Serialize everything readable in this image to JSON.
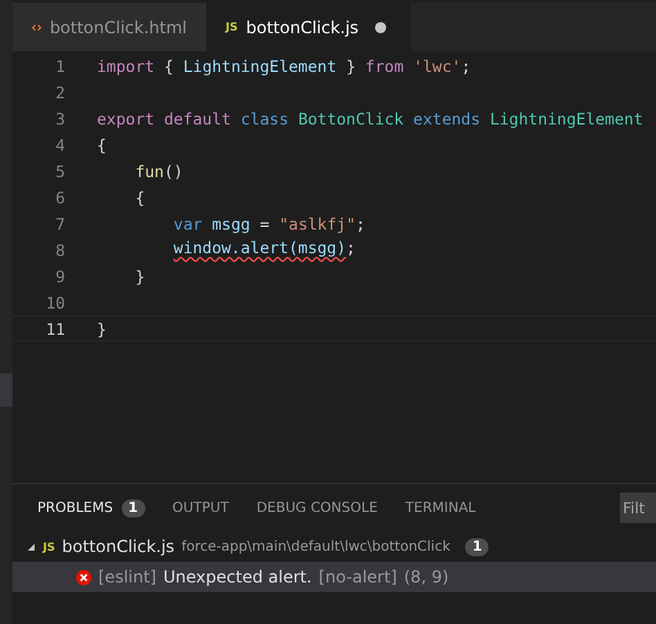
{
  "tabs": [
    {
      "label": "bottonClick.html",
      "kind": "html",
      "selected": false,
      "dirty": false
    },
    {
      "label": "bottonClick.js",
      "kind": "js",
      "icon_text": "JS",
      "selected": true,
      "dirty": true
    }
  ],
  "editor": {
    "lines": [
      {
        "number": "1",
        "current": false,
        "tokens": [
          {
            "text": "import",
            "kind": "keyword"
          },
          {
            "text": " { ",
            "kind": "plain"
          },
          {
            "text": "LightningElement",
            "kind": "variable"
          },
          {
            "text": " } ",
            "kind": "plain"
          },
          {
            "text": "from",
            "kind": "keyword"
          },
          {
            "text": " 'lwc'",
            "kind": "string"
          },
          {
            "text": ";",
            "kind": "plain"
          }
        ]
      },
      {
        "number": "2",
        "current": false
      },
      {
        "number": "3",
        "current": false,
        "tokens": [
          {
            "text": "export default",
            "kind": "keyword"
          },
          {
            "text": " class",
            "kind": "storage"
          },
          {
            "text": " BottonClick",
            "kind": "type"
          },
          {
            "text": " extends",
            "kind": "storage"
          },
          {
            "text": " LightningElement",
            "kind": "type"
          }
        ]
      },
      {
        "number": "4",
        "current": false,
        "tokens": [
          {
            "text": "{",
            "kind": "plain"
          }
        ]
      },
      {
        "number": "5",
        "current": false,
        "tokens": [
          {
            "text": "    fun",
            "kind": "function"
          },
          {
            "text": "()",
            "kind": "plain"
          }
        ]
      },
      {
        "number": "6",
        "current": false,
        "tokens": [
          {
            "text": "    {",
            "kind": "plain"
          }
        ]
      },
      {
        "number": "7",
        "current": false,
        "tokens": [
          {
            "text": "        var",
            "kind": "storage"
          },
          {
            "text": " msgg",
            "kind": "variable"
          },
          {
            "text": " = ",
            "kind": "plain"
          },
          {
            "text": "\"aslkfj\"",
            "kind": "string"
          },
          {
            "text": ";",
            "kind": "plain"
          }
        ]
      },
      {
        "number": "8",
        "current": false,
        "tokens": [
          {
            "text": "        window.alert(msgg)",
            "kind": "variable",
            "error": true
          },
          {
            "text": ";",
            "kind": "plain"
          }
        ]
      },
      {
        "number": "9",
        "current": false,
        "tokens": [
          {
            "text": "    }",
            "kind": "plain"
          }
        ]
      },
      {
        "number": "10",
        "current": false
      },
      {
        "number": "11",
        "current": true,
        "tokens": [
          {
            "text": "}",
            "kind": "plain"
          }
        ]
      }
    ]
  },
  "panel": {
    "tabs": [
      {
        "label": "PROBLEMS",
        "badge": "1",
        "selected": true
      },
      {
        "label": "OUTPUT",
        "selected": false
      },
      {
        "label": "DEBUG CONSOLE",
        "selected": false
      },
      {
        "label": "TERMINAL",
        "selected": false
      }
    ],
    "filter": {
      "placeholder": "Filt"
    },
    "files": [
      {
        "expanded": true,
        "icon_text": "JS",
        "name": "bottonClick.js",
        "path": "force-app\\main\\default\\lwc\\bottonClick",
        "count": "1",
        "problems": [
          {
            "kind": "error",
            "selected": true,
            "source": "[eslint]",
            "message": "Unexpected alert.",
            "rule": "[no-alert]",
            "position": "(8, 9)"
          }
        ]
      }
    ]
  }
}
